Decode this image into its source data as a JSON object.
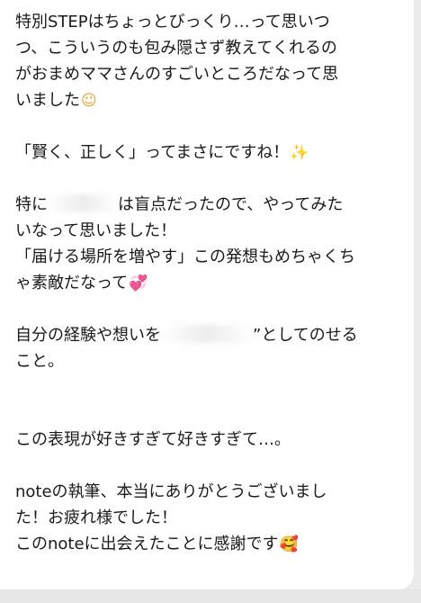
{
  "message": {
    "p1": {
      "l1": "特別STEPはちょっとびっくり…って思いつ",
      "l2": "つ、こういうのも包み隠さず教えてくれるの",
      "l3": "がおまめママさんのすごいところだなって思",
      "l4": "いました",
      "l4_emoji": "☺"
    },
    "p2": {
      "l1": "「賢く、正しく」ってまさにですね！",
      "l1_emoji": "✨"
    },
    "p3": {
      "l1a": "特に",
      "l1b": "は盲点だったので、やってみた",
      "l2": "いなって思いました！",
      "l3": "「届ける場所を増やす」この発想もめちゃくち",
      "l4": "ゃ素敵だなって",
      "l4_emoji": "💞"
    },
    "p4": {
      "l1a": "自分の経験や想いを",
      "l1b": "”としてのせる",
      "l2": "こと。"
    },
    "p5": {
      "l1": "この表現が好きすぎて好きすぎて…。"
    },
    "p6": {
      "l1": "noteの執筆、本当にありがとうございまし",
      "l2": "た！お疲れ様でした！",
      "l3": "このnoteに出会えたことに感謝です",
      "l3_emoji": "🥰"
    }
  }
}
